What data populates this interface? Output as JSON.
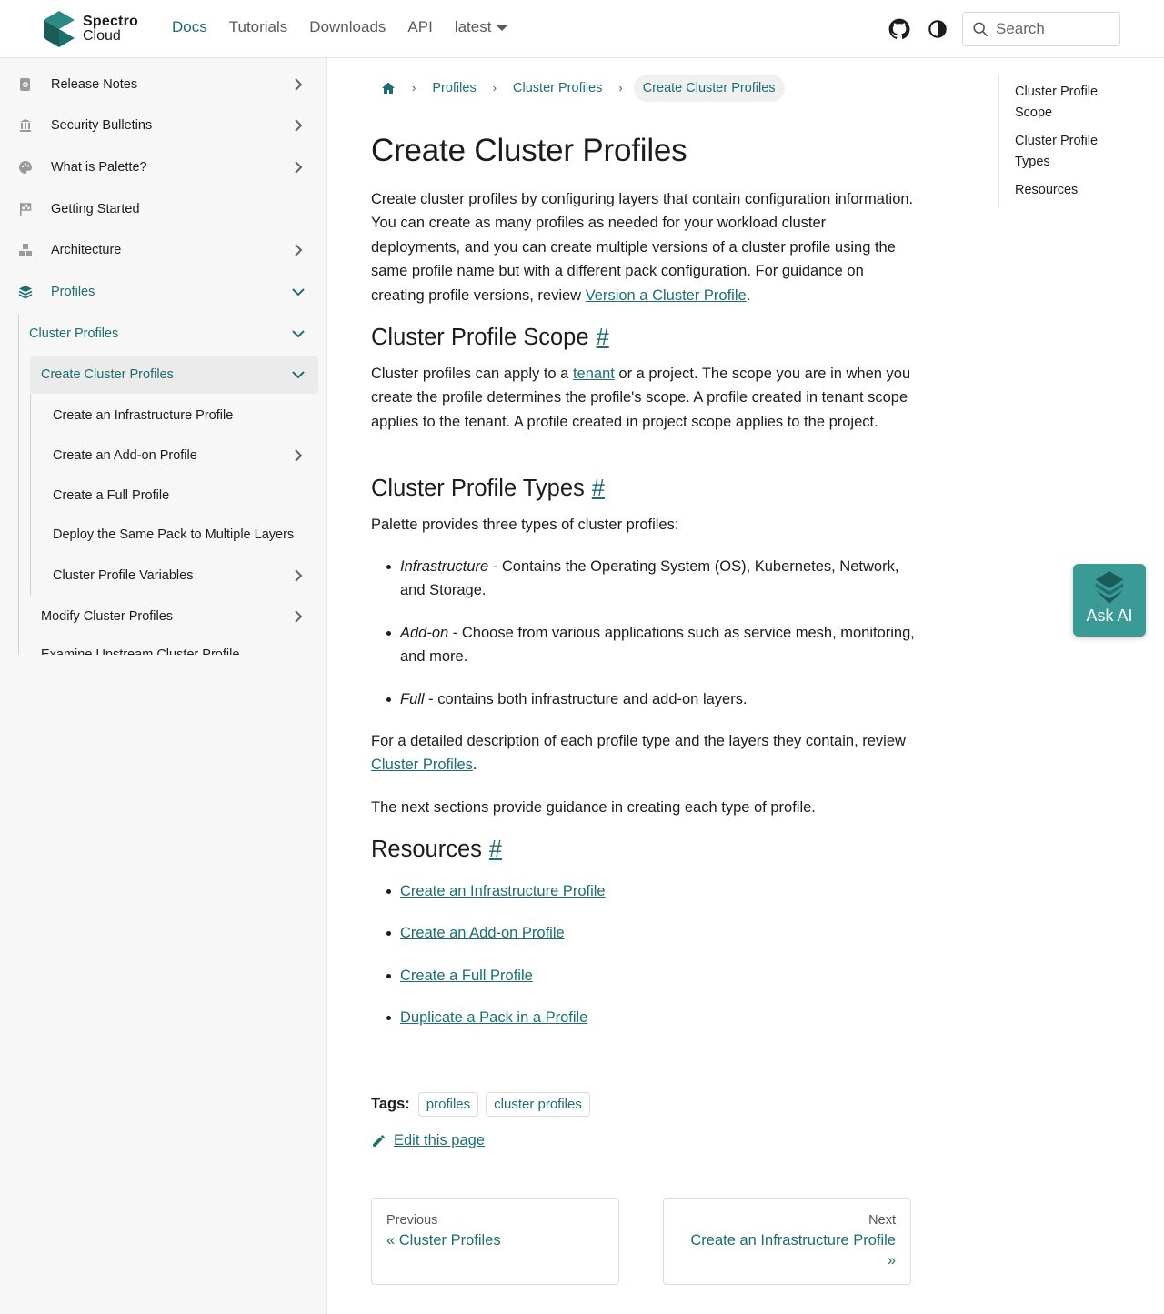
{
  "header": {
    "logo_line1": "Spectro",
    "logo_line2": "Cloud",
    "nav": [
      "Docs",
      "Tutorials",
      "Downloads",
      "API"
    ],
    "version": "latest",
    "search_placeholder": "Search"
  },
  "sidebar": {
    "top_items": [
      {
        "label": "Release Notes",
        "icon": "release-notes-icon",
        "expandable": true
      },
      {
        "label": "Security Bulletins",
        "icon": "security-icon",
        "expandable": true
      },
      {
        "label": "What is Palette?",
        "icon": "palette-icon",
        "expandable": true
      },
      {
        "label": "Getting Started",
        "icon": "flag-icon",
        "expandable": false
      },
      {
        "label": "Architecture",
        "icon": "architecture-icon",
        "expandable": true
      },
      {
        "label": "Profiles",
        "icon": "profiles-icon",
        "expandable": true
      }
    ],
    "cluster_profiles": "Cluster Profiles",
    "create_cluster_profiles": "Create Cluster Profiles",
    "sub_items": [
      "Create an Infrastructure Profile",
      "Create an Add-on Profile",
      "Create a Full Profile",
      "Deploy the Same Pack to Multiple Layers",
      "Cluster Profile Variables"
    ],
    "modify": "Modify Cluster Profiles",
    "cut_item": "Examine Upstream Cluster Profile"
  },
  "breadcrumb": {
    "items": [
      "Profiles",
      "Cluster Profiles"
    ],
    "current": "Create Cluster Profiles"
  },
  "article": {
    "title": "Create Cluster Profiles",
    "intro_text": "Create cluster profiles by configuring layers that contain configuration information. You can create as many profiles as needed for your workload cluster deployments, and you can create multiple versions of a cluster profile using the same profile name but with a different pack configuration. For guidance on creating profile versions, review ",
    "intro_link": "Version a Cluster Profile",
    "scope_heading": "Cluster Profile Scope",
    "scope_text_1": "Cluster profiles can apply to a ",
    "scope_link": "tenant",
    "scope_text_2": " or a project. The scope you are in when you create the profile determines the profile's scope. A profile created in tenant scope applies to the tenant. A profile created in project scope applies to the project.",
    "types_heading": "Cluster Profile Types",
    "types_intro": "Palette provides three types of cluster profiles:",
    "types": [
      {
        "name": "Infrastructure",
        "desc": " - Contains the Operating System (OS), Kubernetes, Network, and Storage."
      },
      {
        "name": "Add-on",
        "desc": " - Choose from various applications such as service mesh, monitoring, and more."
      },
      {
        "name": "Full",
        "desc": " - contains both infrastructure and add-on layers."
      }
    ],
    "detail_text": "For a detailed description of each profile type and the layers they contain, review ",
    "detail_link": "Cluster Profiles",
    "next_text": "The next sections provide guidance in creating each type of profile.",
    "resources_heading": "Resources",
    "resources": [
      "Create an Infrastructure Profile",
      "Create an Add-on Profile",
      "Create a Full Profile",
      "Duplicate a Pack in a Profile"
    ],
    "hash": "#"
  },
  "tags": {
    "label": "Tags:",
    "items": [
      "profiles",
      "cluster profiles"
    ]
  },
  "edit_label": "Edit this page",
  "pager": {
    "prev_label": "Previous",
    "prev_title": "« Cluster Profiles",
    "next_label": "Next",
    "next_title": "Create an Infrastructure Profile »"
  },
  "toc": [
    "Cluster Profile Scope",
    "Cluster Profile Types",
    "Resources"
  ],
  "ask_ai": "Ask AI",
  "colors": {
    "accent": "#1c6e70",
    "ask_ai_bg": "#3a9a96"
  }
}
